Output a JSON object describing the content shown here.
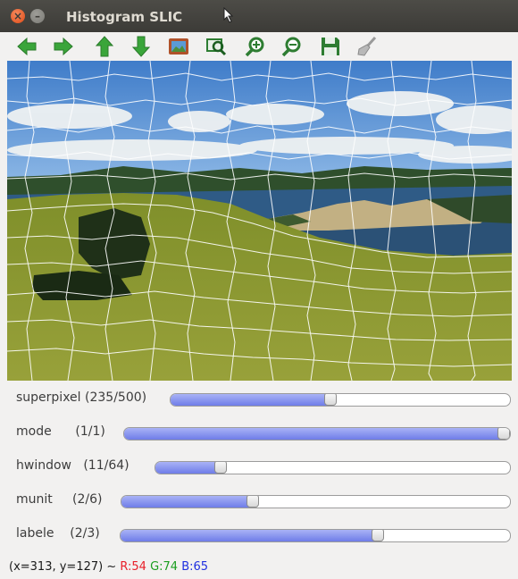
{
  "window": {
    "title": "Histogram SLIC",
    "close_glyph": "×",
    "min_glyph": "–"
  },
  "toolbar": {
    "items": [
      {
        "icon": "arrow-left-icon",
        "color": "#3aa53a"
      },
      {
        "icon": "arrow-right-icon",
        "color": "#3aa53a"
      },
      {
        "icon": "arrow-up-icon",
        "color": "#3aa53a"
      },
      {
        "icon": "arrow-down-icon",
        "color": "#3aa53a"
      },
      {
        "icon": "image-icon",
        "color": "#b0522a"
      },
      {
        "icon": "zoom-region-icon",
        "color": "#2e7d32"
      },
      {
        "icon": "zoom-in-icon",
        "color": "#2e7d32"
      },
      {
        "icon": "zoom-out-icon",
        "color": "#2e7d32"
      },
      {
        "icon": "save-icon",
        "color": "#2e7d32"
      },
      {
        "icon": "brush-icon",
        "color": "#9a9a9a"
      }
    ]
  },
  "trackbars": [
    {
      "label": "superpixel (235/500)",
      "value": 235,
      "max": 500
    },
    {
      "label": "mode      (1/1)",
      "value": 1,
      "max": 1
    },
    {
      "label": "hwindow   (11/64)",
      "value": 11,
      "max": 64
    },
    {
      "label": "munit     (2/6)",
      "value": 2,
      "max": 6
    },
    {
      "label": "labele    (2/3)",
      "value": 2,
      "max": 3
    }
  ],
  "status": {
    "coords": "(x=313, y=127) ~ ",
    "r": "R:54",
    "g": "G:74",
    "b": "B:65",
    "colors": {
      "r": "#e8202a",
      "g": "#1b9e20",
      "b": "#2030e0"
    }
  }
}
